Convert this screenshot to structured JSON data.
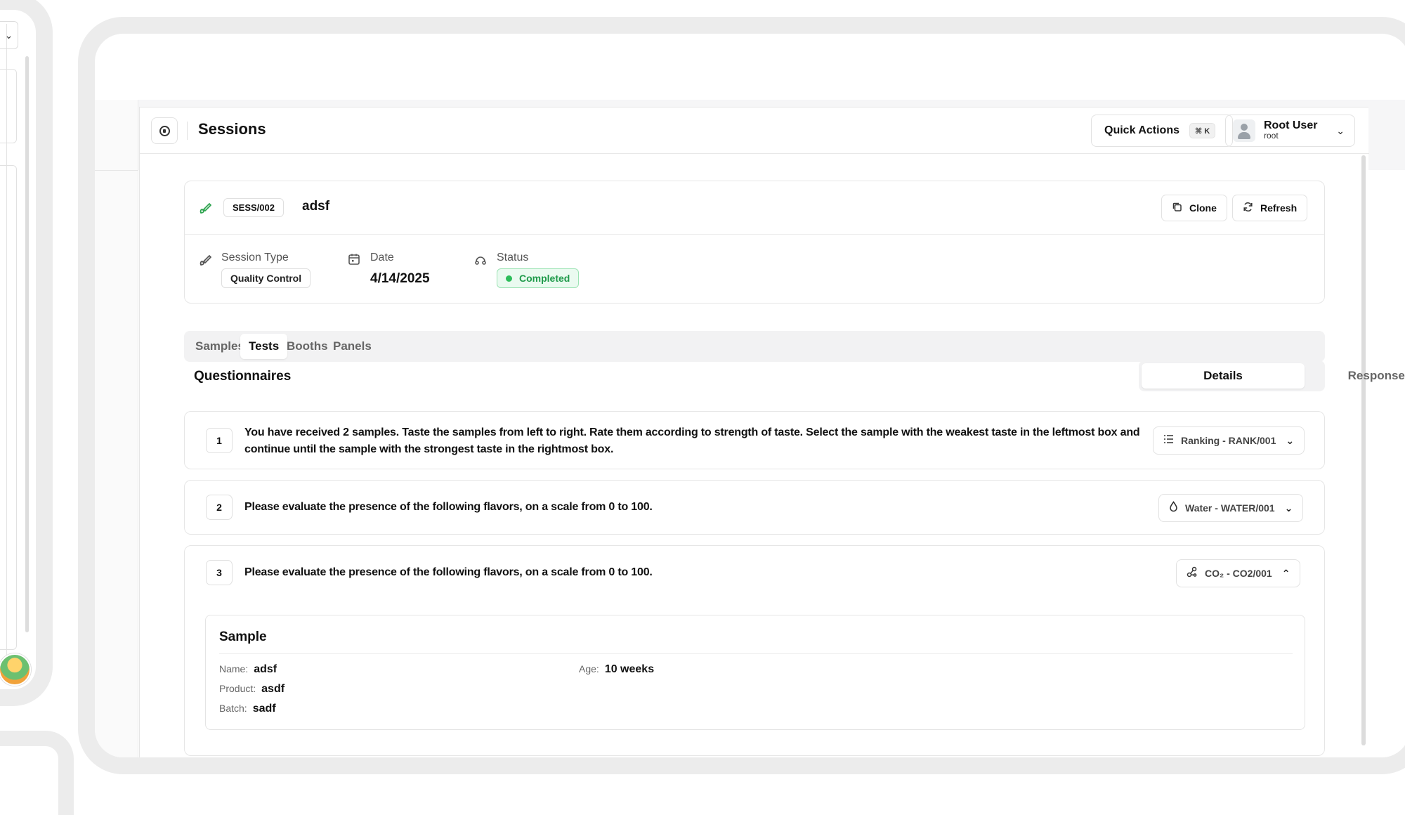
{
  "header": {
    "title": "Sessions",
    "quick_actions_label": "Quick Actions",
    "quick_actions_shortcut": "⌘ K",
    "user_name": "Root User",
    "user_handle": "root"
  },
  "session": {
    "code": "SESS/002",
    "name": "adsf",
    "clone_label": "Clone",
    "refresh_label": "Refresh",
    "type_label": "Session Type",
    "type_value": "Quality Control",
    "date_label": "Date",
    "date_value": "4/14/2025",
    "status_label": "Status",
    "status_value": "Completed",
    "status_color": "#2cbd5a"
  },
  "tabs": [
    {
      "label": "Samples",
      "active": false
    },
    {
      "label": "Tests",
      "active": true
    },
    {
      "label": "Booths",
      "active": false
    },
    {
      "label": "Panels",
      "active": false
    }
  ],
  "questionnaires": {
    "title": "Questionnaires",
    "view_toggle": [
      {
        "label": "Details",
        "active": true
      },
      {
        "label": "Responses",
        "active": false
      }
    ],
    "items": [
      {
        "number": "1",
        "text": "You have received 2 samples. Taste the samples from left to right. Rate them according to strength of taste. Select the sample with the weakest taste in the leftmost box and continue until the sample with the strongest taste in the rightmost box.",
        "selector": "Ranking - RANK/001",
        "selector_icon": "list-icon",
        "expanded": false
      },
      {
        "number": "2",
        "text": "Please evaluate the presence of the following flavors, on a scale from 0 to 100.",
        "selector": "Water - WATER/001",
        "selector_icon": "droplet-icon",
        "expanded": false
      },
      {
        "number": "3",
        "text": "Please evaluate the presence of the following flavors, on a scale from 0 to 100.",
        "selector": "CO₂ - CO2/001",
        "selector_icon": "molecule-icon",
        "expanded": true,
        "sample": {
          "title": "Sample",
          "name_label": "Name:",
          "name_value": "adsf",
          "age_label": "Age:",
          "age_value": "10 weeks",
          "product_label": "Product:",
          "product_value": "asdf",
          "batch_label": "Batch:",
          "batch_value": "sadf"
        }
      }
    ]
  }
}
